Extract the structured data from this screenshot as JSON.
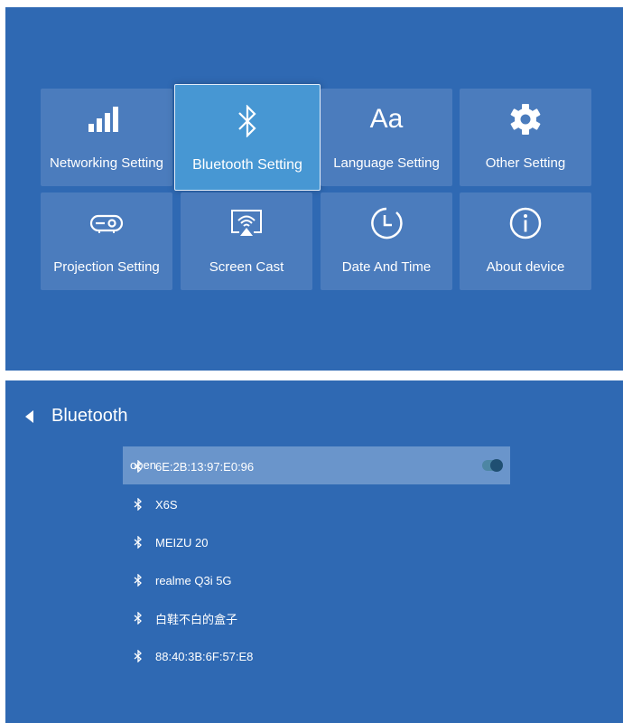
{
  "settings_menu": {
    "tiles": [
      {
        "label": "Networking Setting",
        "icon": "signal-bars-icon"
      },
      {
        "label": "Bluetooth Setting",
        "icon": "bluetooth-icon",
        "selected": true
      },
      {
        "label": "Language Setting",
        "icon": "font-aa-icon",
        "icon_text": "Aa"
      },
      {
        "label": "Other Setting",
        "icon": "gear-icon"
      },
      {
        "label": "Projection Setting",
        "icon": "projector-icon"
      },
      {
        "label": "Screen Cast",
        "icon": "screen-cast-icon"
      },
      {
        "label": "Date And Time",
        "icon": "clock-icon"
      },
      {
        "label": "About device",
        "icon": "info-icon"
      }
    ]
  },
  "bluetooth": {
    "title": "Bluetooth",
    "open_label": "open",
    "open_enabled": true,
    "devices": [
      {
        "name": "6E:2B:13:97:E0:96"
      },
      {
        "name": "X6S"
      },
      {
        "name": "MEIZU 20"
      },
      {
        "name": "realme Q3i 5G"
      },
      {
        "name": "白鞋不白的盒子"
      },
      {
        "name": "88:40:3B:6F:57:E8"
      }
    ]
  },
  "colors": {
    "background": "#2f69b3",
    "tile": "#4b7cbd",
    "tile_selected": "#4797d3",
    "open_row": "#6a95cb"
  }
}
